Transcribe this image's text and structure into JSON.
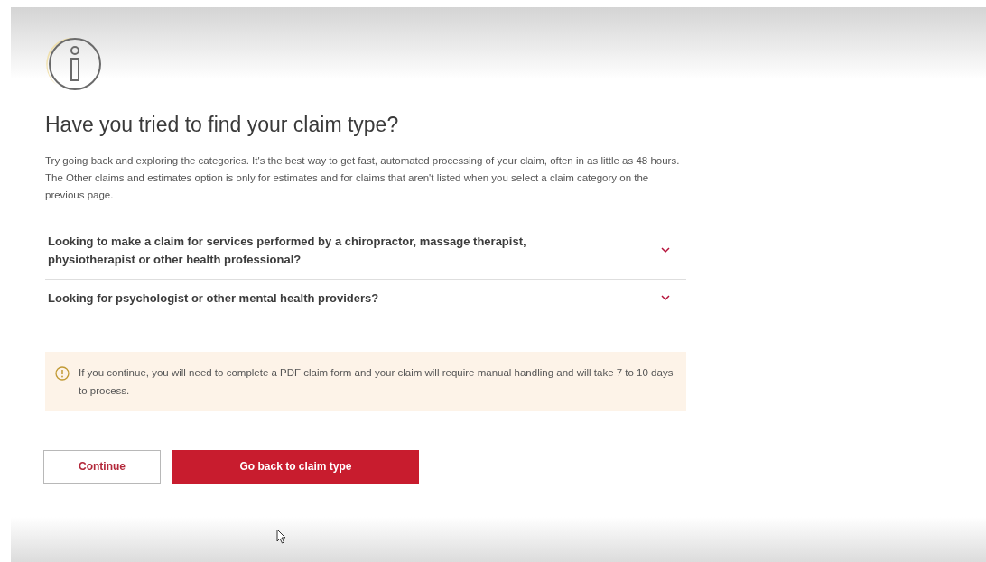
{
  "heading": "Have you tried to find your claim type?",
  "intro": "Try going back and exploring the categories. It's the best way to get fast, automated processing of your claim, often in as little as 48 hours. The Other claims and estimates option is only for estimates and for claims that aren't listed when you select a claim category on the previous page.",
  "accordion": [
    {
      "label": "Looking to make a claim for services performed by a chiropractor, massage therapist, physiotherapist or other health professional?",
      "expanded": false
    },
    {
      "label": "Looking for psychologist or other mental health providers?",
      "expanded": false
    }
  ],
  "warning": "If you continue, you will need to complete a PDF claim form and your claim will require manual handling and will take 7 to 10 days to process.",
  "buttons": [
    {
      "label": "Continue",
      "kind": "secondary"
    },
    {
      "label": "Go back to claim type",
      "kind": "primary"
    }
  ]
}
